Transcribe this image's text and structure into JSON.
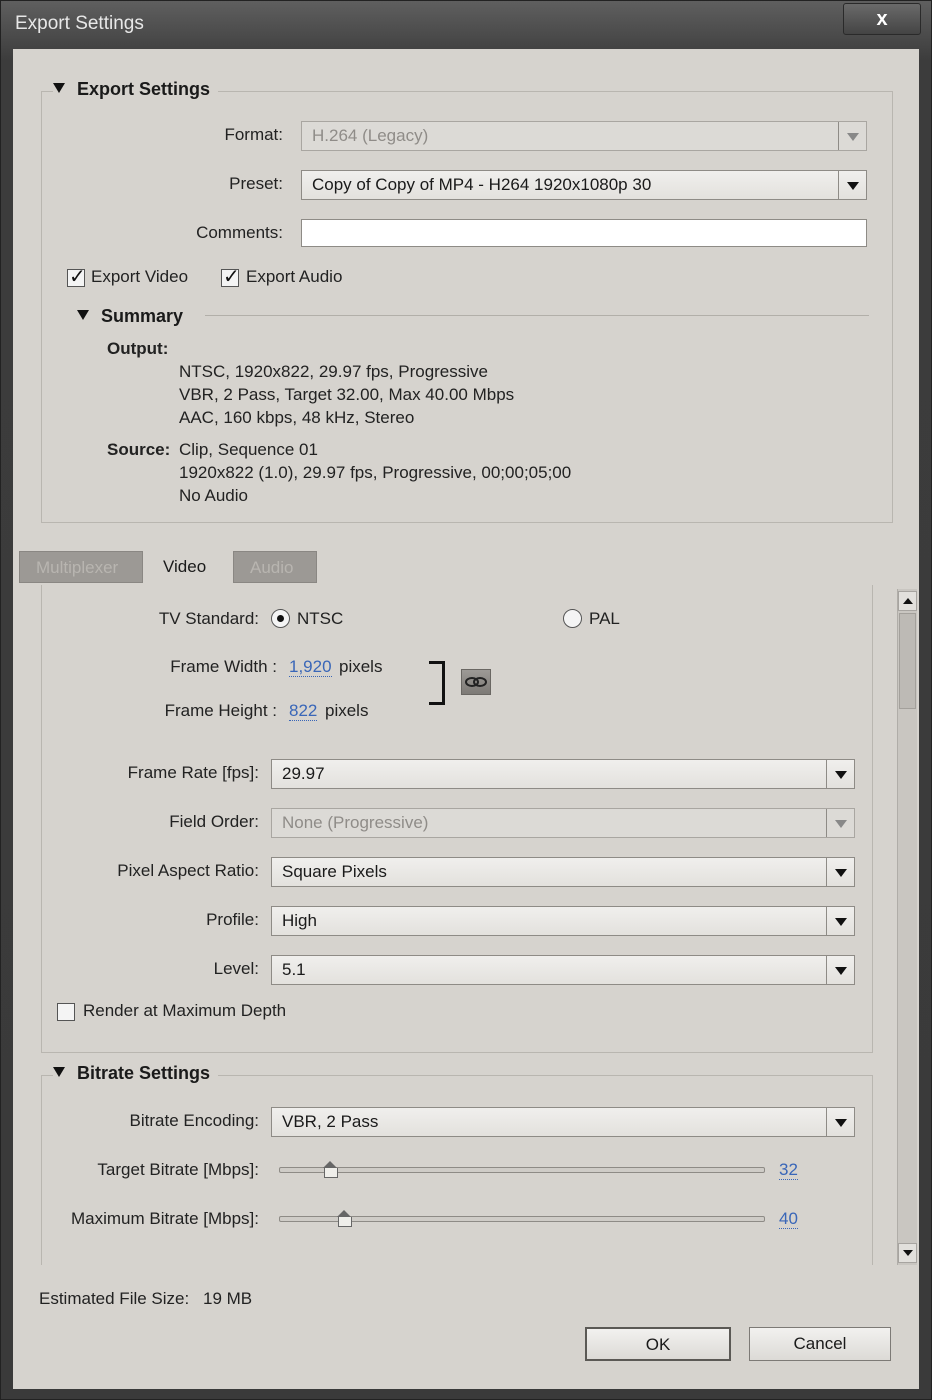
{
  "window": {
    "title": "Export Settings",
    "close_label": "x"
  },
  "export_settings": {
    "heading": "Export Settings",
    "format_label": "Format:",
    "format_value": "H.264 (Legacy)",
    "preset_label": "Preset:",
    "preset_value": "Copy of Copy of MP4 - H264 1920x1080p 30",
    "comments_label": "Comments:",
    "comments_value": "",
    "export_video_label": "Export Video",
    "export_audio_label": "Export Audio",
    "export_video_checked": true,
    "export_audio_checked": true
  },
  "summary": {
    "heading": "Summary",
    "output_label": "Output:",
    "output_lines": [
      "NTSC, 1920x822, 29.97 fps, Progressive",
      "VBR, 2 Pass, Target 32.00, Max 40.00 Mbps",
      "AAC, 160 kbps, 48 kHz, Stereo"
    ],
    "source_label": "Source:",
    "source_lines": [
      "Clip, Sequence 01",
      "1920x822 (1.0), 29.97 fps, Progressive, 00;00;05;00",
      "No Audio"
    ]
  },
  "tabs": [
    {
      "label": "Multiplexer",
      "active": false
    },
    {
      "label": "Video",
      "active": true
    },
    {
      "label": "Audio",
      "active": false
    }
  ],
  "video": {
    "tv_standard_label": "TV Standard:",
    "ntsc_label": "NTSC",
    "pal_label": "PAL",
    "tv_standard_selected": "NTSC",
    "frame_width_label": "Frame Width :",
    "frame_width_value": "1,920",
    "frame_height_label": "Frame Height :",
    "frame_height_value": "822",
    "pixels_unit": "pixels",
    "frame_rate_label": "Frame Rate [fps]:",
    "frame_rate_value": "29.97",
    "field_order_label": "Field Order:",
    "field_order_value": "None (Progressive)",
    "par_label": "Pixel Aspect Ratio:",
    "par_value": "Square Pixels",
    "profile_label": "Profile:",
    "profile_value": "High",
    "level_label": "Level:",
    "level_value": "5.1",
    "render_max_depth_label": "Render at Maximum Depth",
    "render_max_depth_checked": false
  },
  "bitrate": {
    "heading": "Bitrate Settings",
    "encoding_label": "Bitrate Encoding:",
    "encoding_value": "VBR, 2 Pass",
    "target_label": "Target Bitrate [Mbps]:",
    "target_value": "32",
    "max_label": "Maximum Bitrate [Mbps]:",
    "max_value": "40"
  },
  "footer": {
    "file_size_label": "Estimated File Size:",
    "file_size_value": "19 MB",
    "ok_label": "OK",
    "cancel_label": "Cancel"
  }
}
